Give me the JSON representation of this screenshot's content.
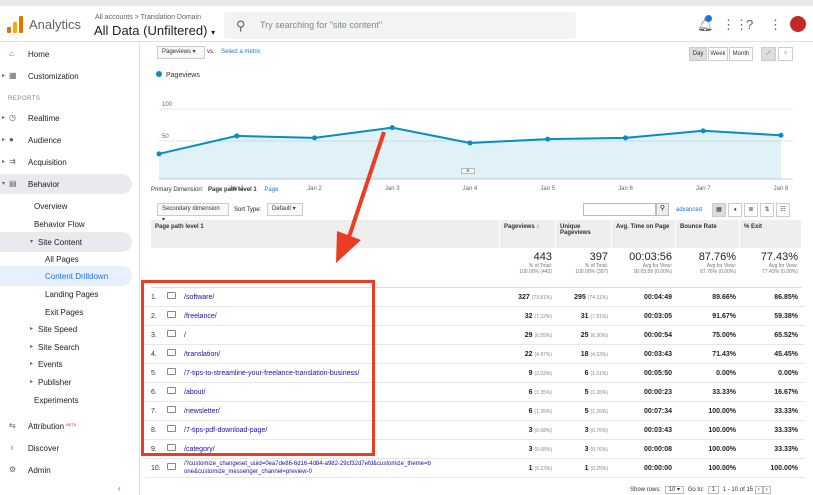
{
  "header": {
    "app_name": "Analytics",
    "account_path": "All accounts > Translation Domain",
    "view_name": "All Data (Unfiltered)",
    "search_placeholder": "Try searching for \"site content\""
  },
  "sidebar": {
    "home": "Home",
    "customization": "Customization",
    "reports_heading": "REPORTS",
    "realtime": "Realtime",
    "audience": "Audience",
    "acquisition": "Acquisition",
    "behavior": "Behavior",
    "overview": "Overview",
    "behavior_flow": "Behavior Flow",
    "site_content": "Site Content",
    "all_pages": "All Pages",
    "content_drilldown": "Content Drilldown",
    "landing_pages": "Landing Pages",
    "exit_pages": "Exit Pages",
    "site_speed": "Site Speed",
    "site_search": "Site Search",
    "events": "Events",
    "publisher": "Publisher",
    "experiments": "Experiments",
    "attribution": "Attribution",
    "beta": "BETA",
    "discover": "Discover",
    "admin": "Admin"
  },
  "controls": {
    "metric": "Pageviews",
    "vs": "vs.",
    "select_metric": "Select a metric",
    "day": "Day",
    "week": "Week",
    "month": "Month"
  },
  "chart_data": {
    "type": "line",
    "series": [
      {
        "name": "Pageviews",
        "values": [
          30,
          58,
          55,
          71,
          47,
          53,
          55,
          66,
          59
        ]
      }
    ],
    "x": [
      "",
      "Jan 1",
      "Jan 2",
      "Jan 3",
      "Jan 4",
      "Jan 5",
      "Jan 6",
      "Jan 7",
      "Jan 8"
    ],
    "ylim": [
      0,
      100
    ],
    "yticks": [
      "100",
      "50"
    ],
    "color": "#058dc7"
  },
  "dimension": {
    "label": "Primary Dimension:",
    "current": "Page path level 1",
    "other": "Page"
  },
  "toolbar": {
    "secondary": "Secondary dimension",
    "sort_label": "Sort Type:",
    "sort_value": "Default",
    "advanced": "advanced"
  },
  "table": {
    "headers": [
      "Page path level 1",
      "Pageviews",
      "Unique Pageviews",
      "Avg. Time on Page",
      "Bounce Rate",
      "% Exit"
    ],
    "totals": [
      {
        "big": "443",
        "l1": "% of Total:",
        "l2": "100.00% (443)"
      },
      {
        "big": "397",
        "l1": "% of Total:",
        "l2": "100.00% (397)"
      },
      {
        "big": "00:03:56",
        "l1": "Avg for View:",
        "l2": "00:03:56 (0.00%)"
      },
      {
        "big": "87.76%",
        "l1": "Avg for View:",
        "l2": "87.76% (0.00%)"
      },
      {
        "big": "77.43%",
        "l1": "Avg for View:",
        "l2": "77.43% (0.00%)"
      }
    ],
    "rows": [
      {
        "n": "1.",
        "path": "/software/",
        "pv": "327",
        "pvp": "(73.81%)",
        "upv": "295",
        "upvp": "(74.31%)",
        "time": "00:04:49",
        "bounce": "89.66%",
        "exit": "86.85%"
      },
      {
        "n": "2.",
        "path": "/freelance/",
        "pv": "32",
        "pvp": "(7.22%)",
        "upv": "31",
        "upvp": "(7.81%)",
        "time": "00:03:05",
        "bounce": "91.67%",
        "exit": "59.38%"
      },
      {
        "n": "3.",
        "path": "/",
        "pv": "29",
        "pvp": "(6.55%)",
        "upv": "25",
        "upvp": "(6.30%)",
        "time": "00:00:54",
        "bounce": "75.00%",
        "exit": "65.52%"
      },
      {
        "n": "4.",
        "path": "/translation/",
        "pv": "22",
        "pvp": "(4.97%)",
        "upv": "18",
        "upvp": "(4.53%)",
        "time": "00:03:43",
        "bounce": "71.43%",
        "exit": "45.45%"
      },
      {
        "n": "5.",
        "path": "/7-tips-to-streamline-your-freelance-translation-business/",
        "pv": "9",
        "pvp": "(2.03%)",
        "upv": "6",
        "upvp": "(1.51%)",
        "time": "00:05:50",
        "bounce": "0.00%",
        "exit": "0.00%"
      },
      {
        "n": "6.",
        "path": "/about/",
        "pv": "6",
        "pvp": "(1.35%)",
        "upv": "5",
        "upvp": "(1.26%)",
        "time": "00:00:23",
        "bounce": "33.33%",
        "exit": "16.67%"
      },
      {
        "n": "7.",
        "path": "/newsletter/",
        "pv": "6",
        "pvp": "(1.35%)",
        "upv": "5",
        "upvp": "(1.26%)",
        "time": "00:07:34",
        "bounce": "100.00%",
        "exit": "33.33%"
      },
      {
        "n": "8.",
        "path": "/7-tips-pdf-download-page/",
        "pv": "3",
        "pvp": "(0.68%)",
        "upv": "3",
        "upvp": "(0.76%)",
        "time": "00:03:43",
        "bounce": "100.00%",
        "exit": "33.33%"
      },
      {
        "n": "9.",
        "path": "/category/",
        "pv": "3",
        "pvp": "(0.68%)",
        "upv": "3",
        "upvp": "(0.76%)",
        "time": "00:00:08",
        "bounce": "100.00%",
        "exit": "33.33%"
      },
      {
        "n": "10.",
        "path": "/?customize_changeset_uuid=0ea7de86-6d16-4d84-a982-29cf32d7efd&customize_theme=bone&customize_messenger_channel=preview-0",
        "pv": "1",
        "pvp": "(0.23%)",
        "upv": "1",
        "upvp": "(0.25%)",
        "time": "00:00:00",
        "bounce": "100.00%",
        "exit": "100.00%"
      }
    ]
  },
  "pager": {
    "show_rows": "Show rows:",
    "rows": "10",
    "goto": "Go to:",
    "page": "1",
    "range": "1 - 10 of 15"
  }
}
